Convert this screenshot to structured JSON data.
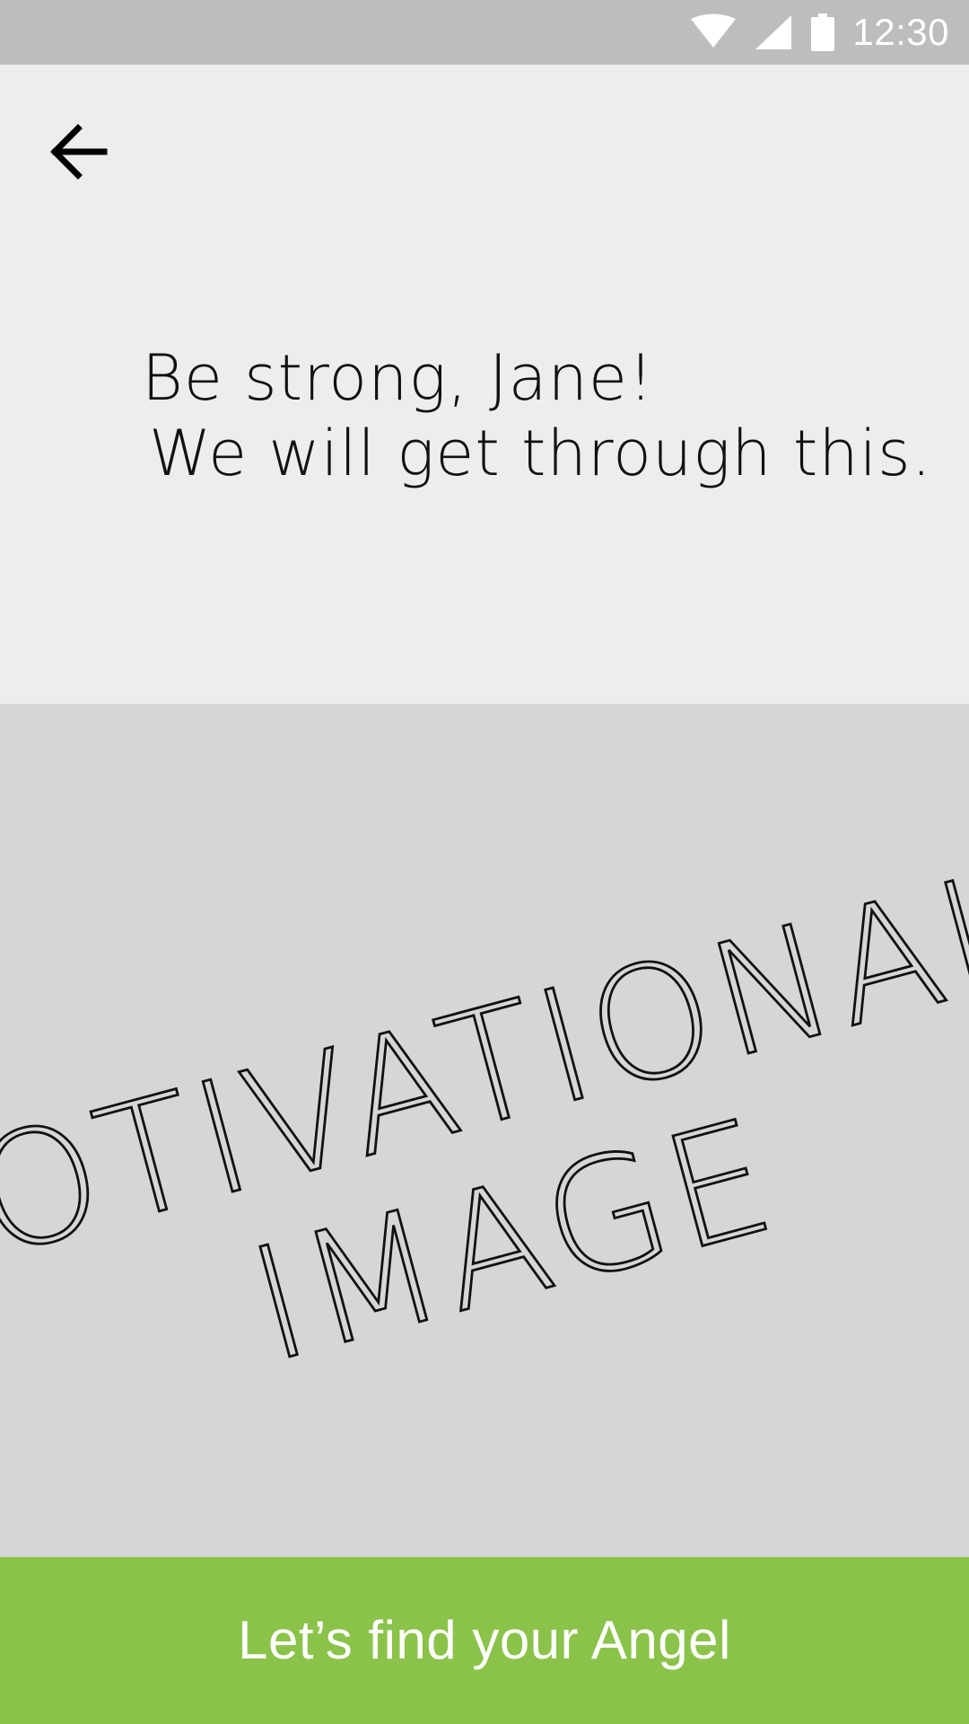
{
  "status_bar": {
    "time": "12:30",
    "icons": [
      "wifi-icon",
      "cellular-signal-icon",
      "battery-icon"
    ],
    "background_color": "#bdbdbd",
    "icon_color": "#ffffff"
  },
  "header": {
    "back_icon": "arrow-left-icon"
  },
  "message": {
    "line1": "Be strong, Jane!",
    "line2": "We will get through this."
  },
  "image_placeholder": {
    "line1": "MOTIVATIONAL",
    "line2": "IMAGE",
    "background_color": "#d6d6d6"
  },
  "cta": {
    "label": "Let’s find your Angel",
    "background_color": "#8bc34a",
    "text_color": "#ffffff"
  },
  "colors": {
    "page_background": "#ededed"
  }
}
